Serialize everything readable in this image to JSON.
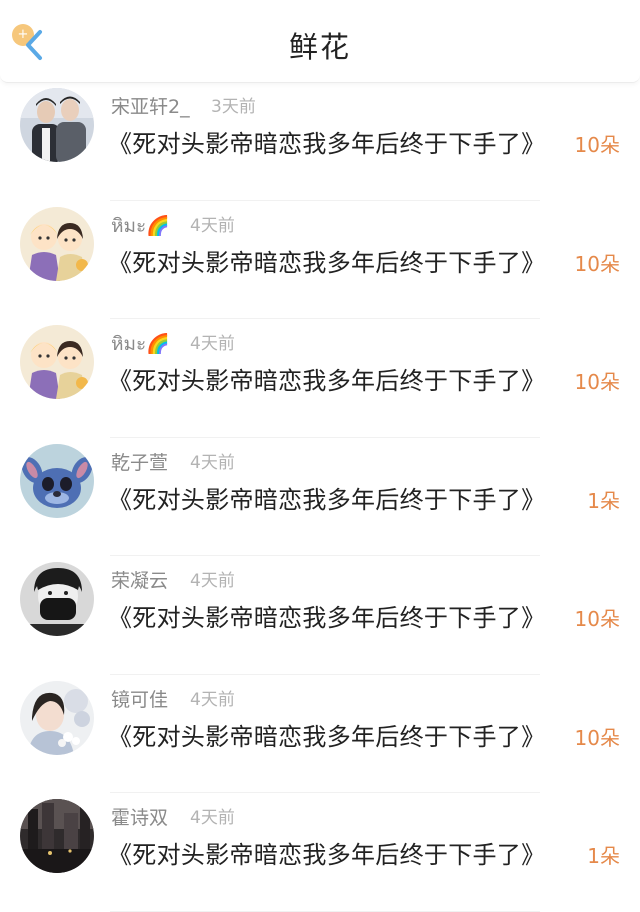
{
  "header": {
    "title": "鲜花",
    "back_badge": "+"
  },
  "colors": {
    "accent": "#e5894a",
    "username": "#8a8a8a",
    "time": "#b3b3b3",
    "text": "#222222"
  },
  "items": [
    {
      "user": "宋亚轩2_",
      "time": "3天前",
      "book": "《死对头影帝暗恋我多年后终于下手了》",
      "count": "10朵",
      "avatar": "two-men-photo"
    },
    {
      "user": "หิมะ🌈",
      "time": "4天前",
      "book": "《死对头影帝暗恋我多年后终于下手了》",
      "count": "10朵",
      "avatar": "cartoon-couple"
    },
    {
      "user": "หิมะ🌈",
      "time": "4天前",
      "book": "《死对头影帝暗恋我多年后终于下手了》",
      "count": "10朵",
      "avatar": "cartoon-couple"
    },
    {
      "user": "乾子萱",
      "time": "4天前",
      "book": "《死对头影帝暗恋我多年后终于下手了》",
      "count": "1朵",
      "avatar": "stitch-cartoon"
    },
    {
      "user": "荣凝云",
      "time": "4天前",
      "book": "《死对头影帝暗恋我多年后终于下手了》",
      "count": "10朵",
      "avatar": "masked-man-bw"
    },
    {
      "user": "镜可佳",
      "time": "4天前",
      "book": "《死对头影帝暗恋我多年后终于下手了》",
      "count": "10朵",
      "avatar": "girl-flowers"
    },
    {
      "user": "霍诗双",
      "time": "4天前",
      "book": "《死对头影帝暗恋我多年后终于下手了》",
      "count": "1朵",
      "avatar": "dark-street"
    }
  ]
}
